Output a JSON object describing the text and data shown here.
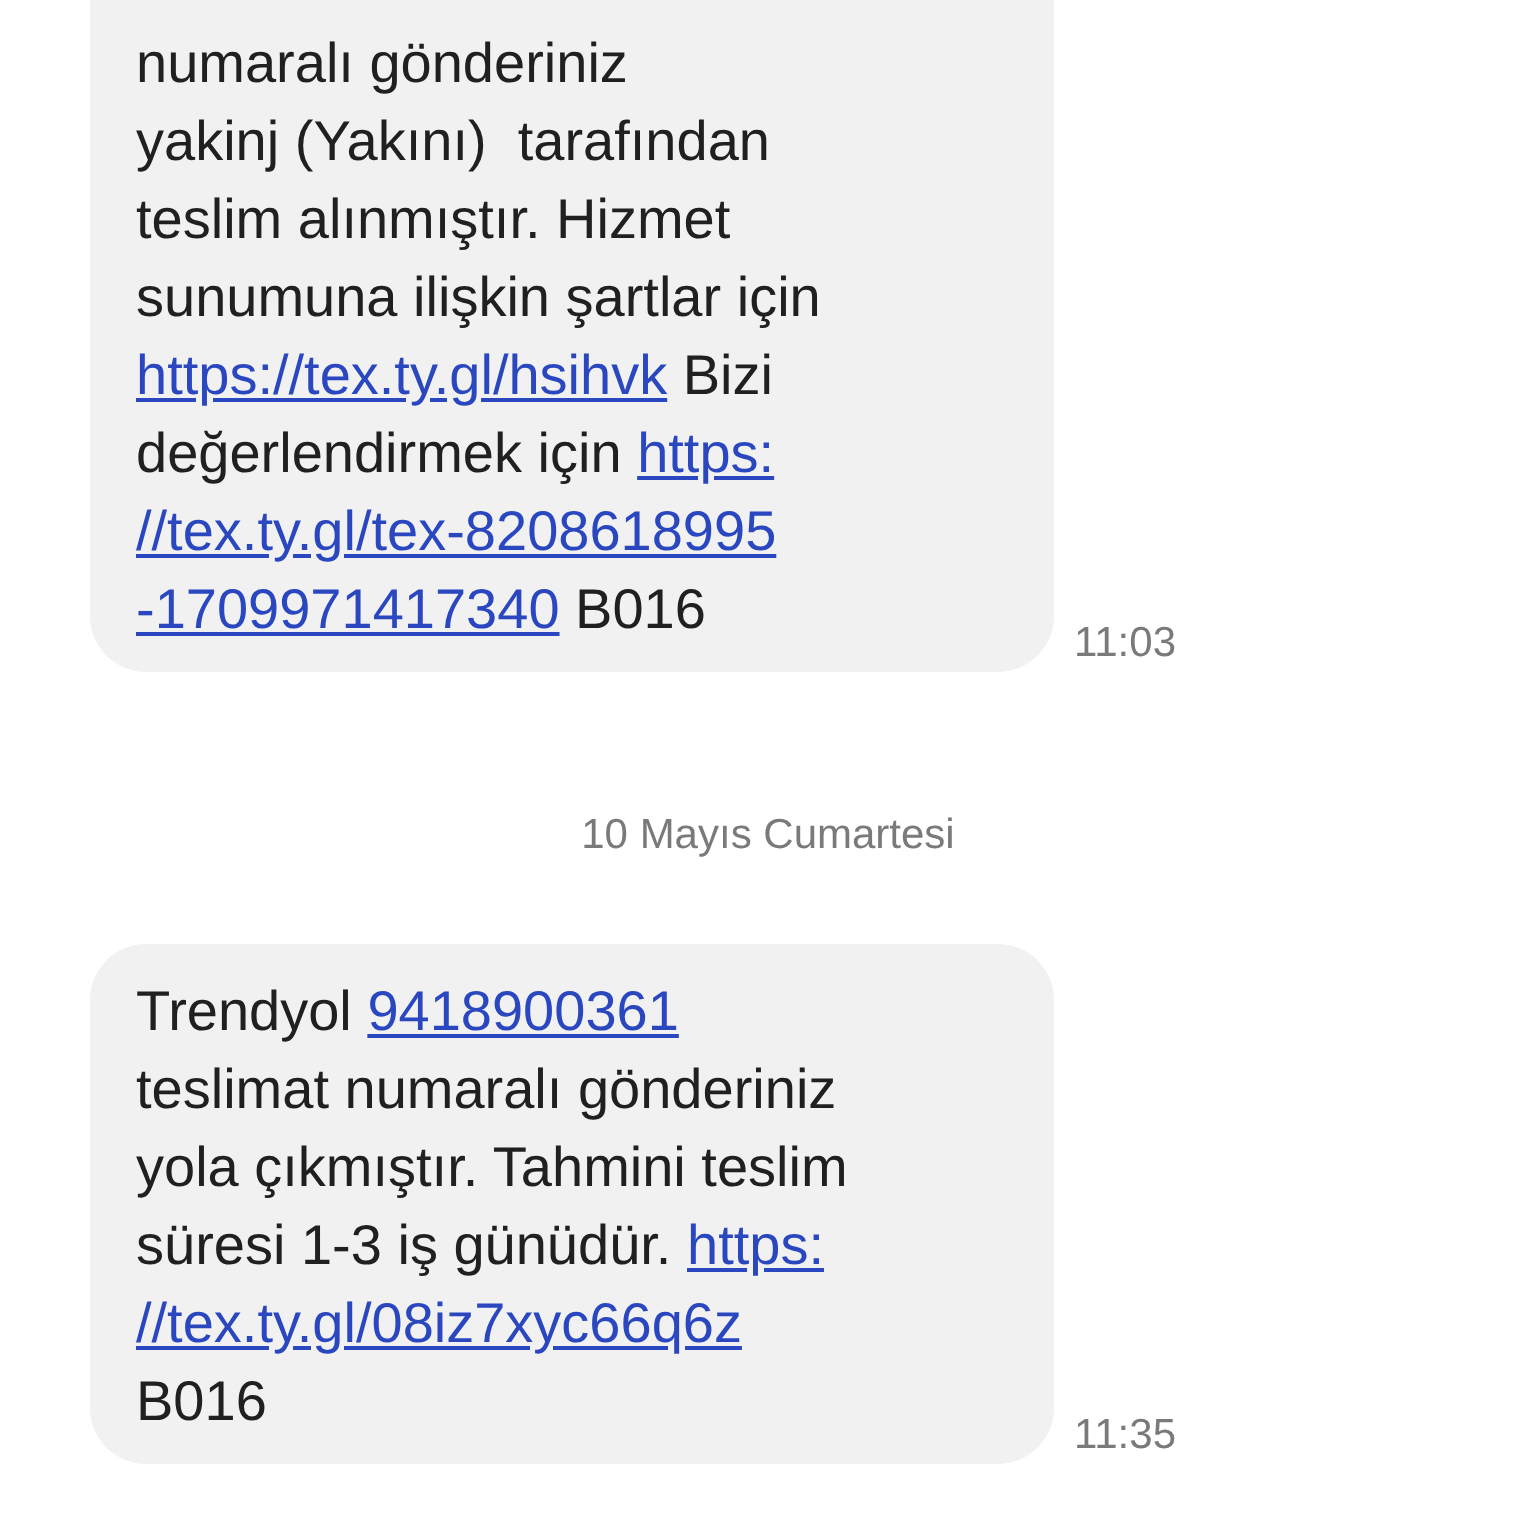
{
  "messages": [
    {
      "lines": [
        [
          {
            "kind": "text",
            "text": "numaralı gönderiniz"
          }
        ],
        [
          {
            "kind": "text",
            "text": "yakinj (Yakını)  tarafından"
          }
        ],
        [
          {
            "kind": "text",
            "text": "teslim alınmıştır. Hizmet"
          }
        ],
        [
          {
            "kind": "text",
            "text": "sunumuna ilişkin şartlar için"
          }
        ],
        [
          {
            "kind": "link",
            "text": "https://tex.ty.gl/hsihvk"
          },
          {
            "kind": "text",
            "text": " Bizi"
          }
        ],
        [
          {
            "kind": "text",
            "text": "değerlendirmek için "
          },
          {
            "kind": "link",
            "text": "https:"
          }
        ],
        [
          {
            "kind": "link",
            "text": "//tex.ty.gl/tex-8208618995"
          }
        ],
        [
          {
            "kind": "link",
            "text": "-1709971417340"
          },
          {
            "kind": "text",
            "text": " B016"
          }
        ]
      ],
      "time": "11:03",
      "date_after": "10 Mayıs Cumartesi"
    },
    {
      "lines": [
        [
          {
            "kind": "text",
            "text": "Trendyol "
          },
          {
            "kind": "link",
            "text": "9418900361"
          }
        ],
        [
          {
            "kind": "text",
            "text": "teslimat numaralı gönderiniz"
          }
        ],
        [
          {
            "kind": "text",
            "text": "yola çıkmıştır. Tahmini teslim"
          }
        ],
        [
          {
            "kind": "text",
            "text": "süresi 1-3 iş günüdür. "
          },
          {
            "kind": "link",
            "text": "https:"
          }
        ],
        [
          {
            "kind": "link",
            "text": "//tex.ty.gl/08iz7xyc66q6z"
          }
        ],
        [
          {
            "kind": "text",
            "text": "B016"
          }
        ]
      ],
      "time": "11:35"
    }
  ]
}
